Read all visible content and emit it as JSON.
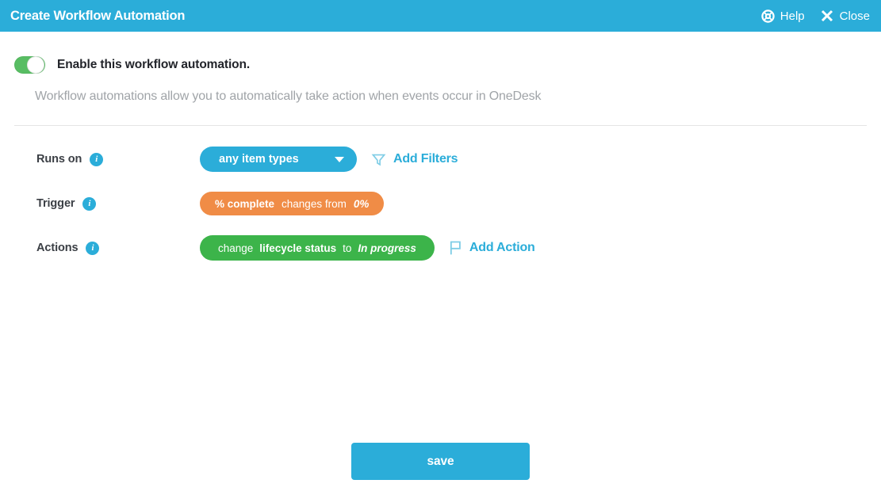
{
  "header": {
    "title": "Create Workflow Automation",
    "help_label": "Help",
    "help_icon": "lifebuoy-icon",
    "close_label": "Close",
    "close_icon": "close-x-icon",
    "background_color": "#2badd9"
  },
  "enable": {
    "label": "Enable this workflow automation.",
    "state": "on",
    "toggle_color": "#58bd63"
  },
  "description": "Workflow automations allow you to automatically take action when events occur in OneDesk",
  "form": {
    "runs_on": {
      "label": "Runs on",
      "info_icon": "info-icon",
      "chip_value": "any item types",
      "chip_color": "#2badd9",
      "dropdown_icon": "chevron-down-icon",
      "add_filters_label": "Add Filters",
      "add_filters_icon": "funnel-icon"
    },
    "trigger": {
      "label": "Trigger",
      "info_icon": "info-icon",
      "chip_color": "#f08c46",
      "chip_field": "% complete",
      "chip_operator": "changes from",
      "chip_value": "0%"
    },
    "actions": {
      "label": "Actions",
      "info_icon": "info-icon",
      "chip_color": "#3cb44a",
      "chip_verb": "change",
      "chip_field": "lifecycle status",
      "chip_joiner": "to",
      "chip_value": "In progress",
      "add_action_label": "Add Action",
      "add_action_icon": "flag-icon"
    }
  },
  "footer": {
    "save_label": "save",
    "save_color": "#2badd9"
  }
}
